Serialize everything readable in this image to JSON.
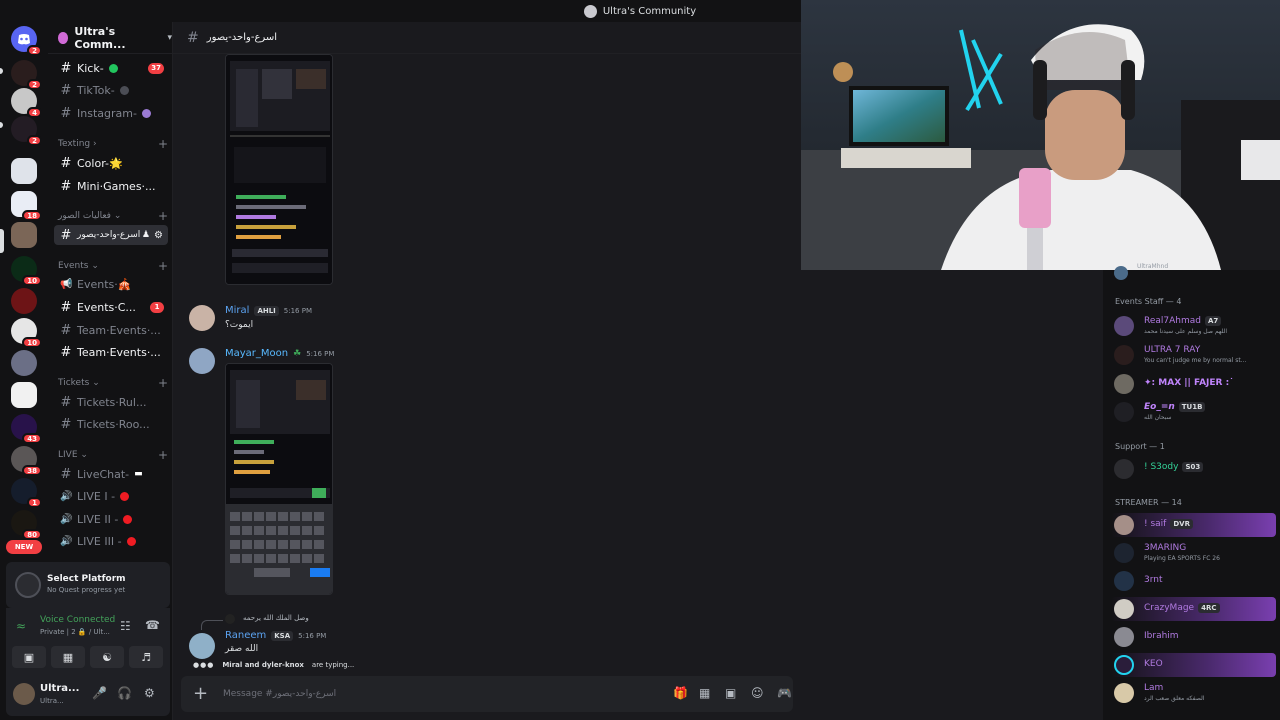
{
  "window": {
    "title": "Ultra's Community"
  },
  "rail": {
    "badges": [
      "2",
      "2",
      "4",
      "2",
      "18",
      "10",
      "10",
      "43",
      "38",
      "1",
      "80"
    ],
    "new_label": "NEW"
  },
  "guild": {
    "name": "Ultra's Comm..."
  },
  "channels": {
    "top": [
      {
        "name": "Kick-",
        "dot": "#22c55e",
        "count": "37"
      },
      {
        "name": "TikTok-",
        "dot": "#4b4d55"
      },
      {
        "name": "Instagram-",
        "dot": "#9b7bd4"
      }
    ],
    "cat_texting": "Texting",
    "texting": [
      {
        "name": "Color-🌟"
      },
      {
        "name": "Mini·Games·..."
      }
    ],
    "cat_arabic": "فعاليات الصور",
    "active_channel": "اسرع-واحد-يصور",
    "cat_events": "Events",
    "events": [
      {
        "name": "Events·🎪"
      },
      {
        "name": "Events·C...",
        "count": "1"
      },
      {
        "name": "Team·Events·..."
      },
      {
        "name": "Team·Events·..."
      }
    ],
    "cat_tickets": "Tickets",
    "tickets": [
      {
        "name": "Tickets·Rul..."
      },
      {
        "name": "Tickets·Roo..."
      }
    ],
    "cat_live": "LIVE",
    "live": [
      {
        "name": "LiveChat-"
      },
      {
        "name": "LIVE I -"
      },
      {
        "name": "LIVE II -"
      },
      {
        "name": "LIVE III -"
      }
    ]
  },
  "quest": {
    "title": "Select Platform",
    "subtitle": "No Quest progress yet"
  },
  "voice": {
    "status": "Voice Connected",
    "detail": "Private | 2 🔒 / Ult..."
  },
  "user": {
    "name": "Ultra...",
    "status": "Ultra..."
  },
  "chat": {
    "channel": "اسرع-واحد-يصور",
    "messages": [
      {
        "author": "Miral",
        "author_color": "#5ba2f0",
        "tag": "AHLI",
        "time": "5:16 PM",
        "text": "ايموت؟"
      },
      {
        "author": "Mayar_Moon",
        "author_color": "#58b9ff",
        "time": "5:16 PM"
      },
      {
        "author": "Raneem",
        "author_color": "#5ba2f0",
        "tag": "KSA",
        "time": "5:16 PM",
        "reply": "وصل الملك الله يرحمه",
        "text": "الله صقر"
      }
    ],
    "typing": {
      "users": "Miral and dyler-knox",
      "suffix": "are typing..."
    },
    "composer_placeholder": "Message #اسرع-واحد-يصور"
  },
  "members": {
    "top_status": "UltraMhnd",
    "groups": [
      {
        "title": "Events Staff — 4"
      },
      {
        "title": "Support — 1"
      },
      {
        "title": "STREAMER — 14"
      }
    ],
    "events_staff": [
      {
        "name": "Real7Ahmad",
        "color": "#b07ae0",
        "tag": "A7",
        "status": "اللهم صل وسلم على سيدنا محمد"
      },
      {
        "name": "ULTRA 7 RAY",
        "color": "#b07ae0",
        "status": "You can't judge me by normal st..."
      },
      {
        "name": "✦: MAX || FAJER :˙",
        "color": "#c084fc"
      },
      {
        "name": "Eo_=n",
        "color": "#c084fc",
        "tag": "TU1B",
        "status": "سبحان الله"
      }
    ],
    "support": [
      {
        "name": "! S3ody",
        "color": "#34d399",
        "tag": "S03"
      }
    ],
    "streamers": [
      {
        "name": "! saif",
        "color": "#b07ae0",
        "tag": "DVR"
      },
      {
        "name": "3MARING",
        "color": "#b07ae0",
        "status": "Playing EA SPORTS FC 26"
      },
      {
        "name": "3rnt",
        "color": "#b07ae0"
      },
      {
        "name": "CrazyMage",
        "color": "#b07ae0",
        "tag": "4RC"
      },
      {
        "name": "Ibrahim",
        "color": "#b07ae0"
      },
      {
        "name": "KEO",
        "color": "#b07ae0"
      },
      {
        "name": "Lam",
        "color": "#b07ae0",
        "status": "الصفكه معلق صعب الرد"
      }
    ]
  }
}
